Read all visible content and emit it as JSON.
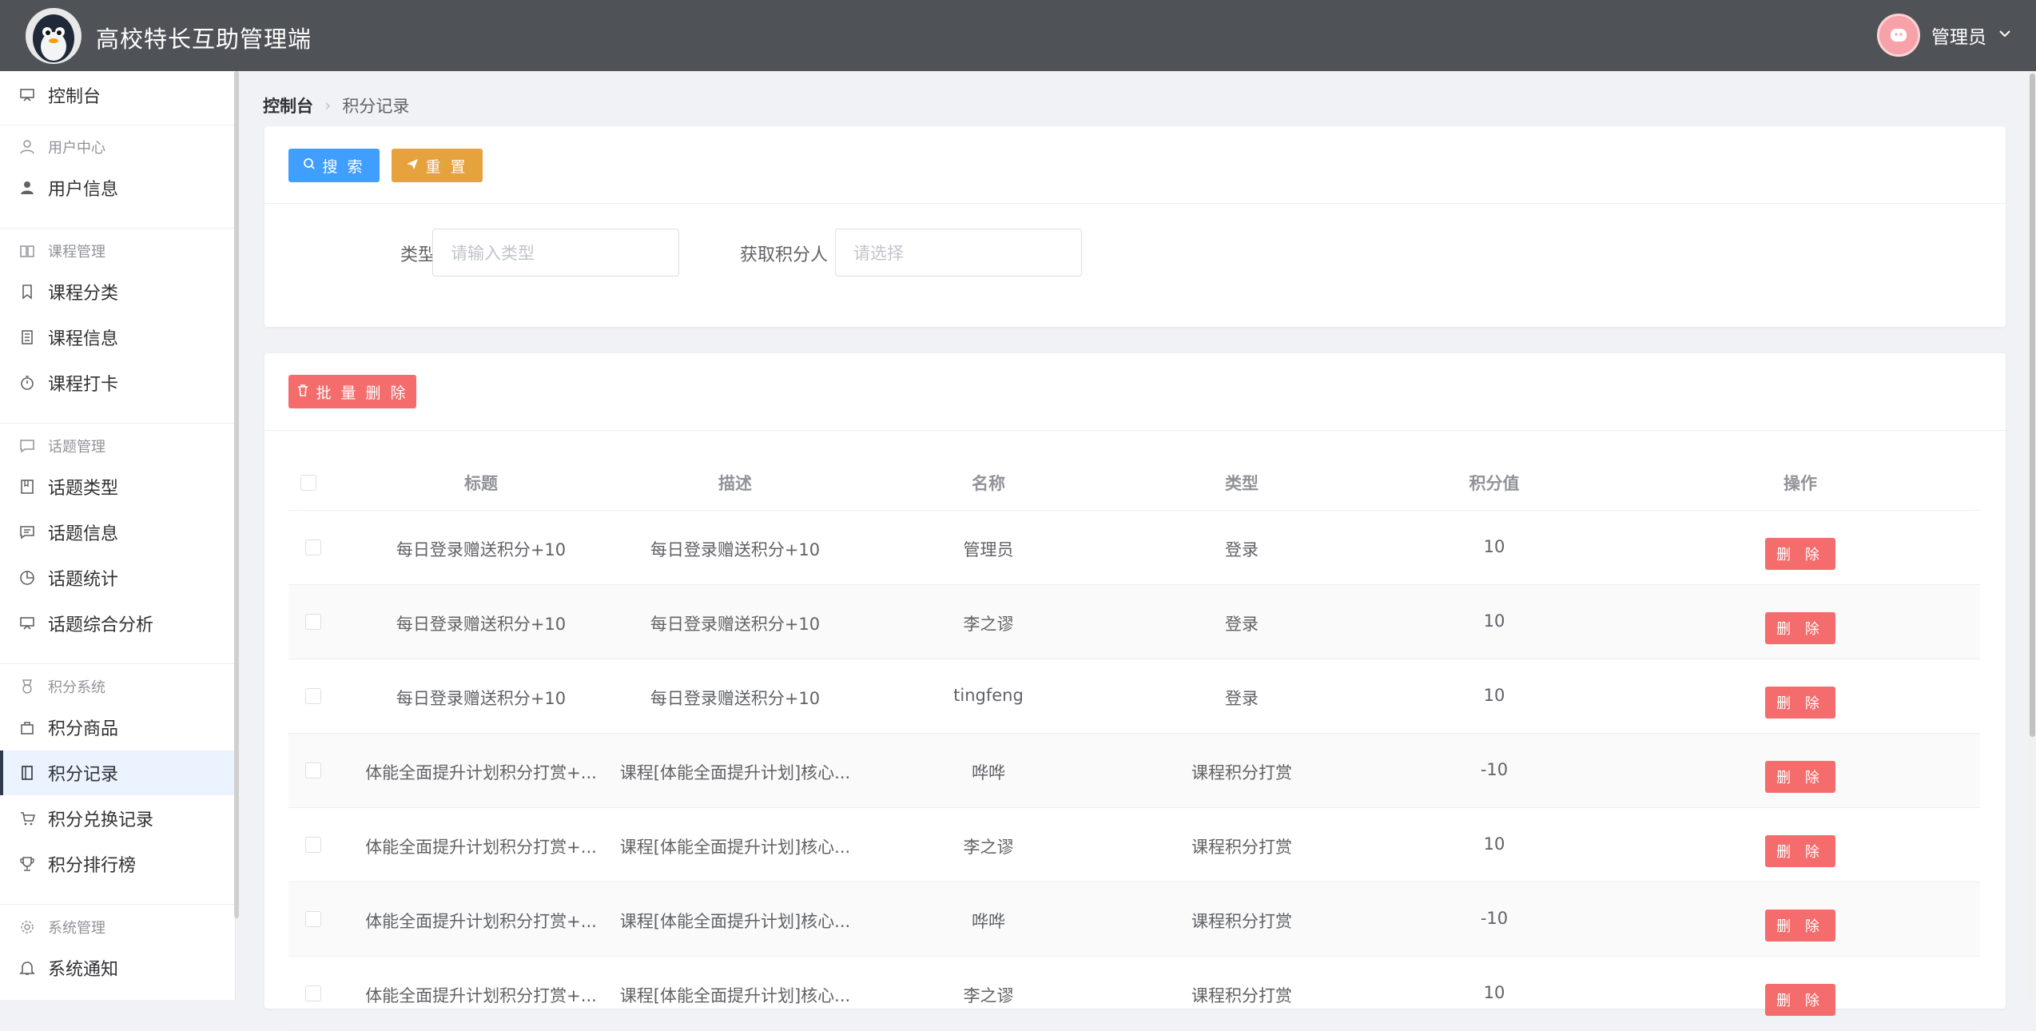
{
  "header": {
    "app_title": "高校特长互助管理端",
    "user_name": "管理员"
  },
  "sidebar": {
    "items": [
      {
        "label": "控制台",
        "icon": "dashboard-icon"
      },
      {
        "group": "用户中心",
        "icon": "user-outline-icon"
      },
      {
        "label": "用户信息",
        "icon": "user-icon"
      },
      {
        "group": "课程管理",
        "icon": "book-icon"
      },
      {
        "label": "课程分类",
        "icon": "bookmark-icon"
      },
      {
        "label": "课程信息",
        "icon": "document-icon"
      },
      {
        "label": "课程打卡",
        "icon": "timer-icon"
      },
      {
        "group": "话题管理",
        "icon": "chat-icon"
      },
      {
        "label": "话题类型",
        "icon": "notebook-icon"
      },
      {
        "label": "话题信息",
        "icon": "message-icon"
      },
      {
        "label": "话题统计",
        "icon": "pie-chart-icon"
      },
      {
        "label": "话题综合分析",
        "icon": "monitor-icon"
      },
      {
        "group": "积分系统",
        "icon": "medal-icon"
      },
      {
        "label": "积分商品",
        "icon": "bag-icon"
      },
      {
        "label": "积分记录",
        "icon": "notebook-icon",
        "active": true
      },
      {
        "label": "积分兑换记录",
        "icon": "cart-icon"
      },
      {
        "label": "积分排行榜",
        "icon": "trophy-icon"
      },
      {
        "group": "系统管理",
        "icon": "gear-icon"
      },
      {
        "label": "系统通知",
        "icon": "bell-icon"
      }
    ]
  },
  "breadcrumb": {
    "home": "控制台",
    "current": "积分记录"
  },
  "toolbar": {
    "search_label": "搜 索",
    "reset_label": "重 置",
    "batch_delete_label": "批 量 删 除"
  },
  "filters": {
    "type_label": "类型",
    "type_placeholder": "请输入类型",
    "user_label": "获取积分人",
    "user_placeholder": "请选择"
  },
  "table": {
    "columns": [
      "标题",
      "描述",
      "名称",
      "类型",
      "积分值",
      "操作"
    ],
    "delete_label": "删 除",
    "rows": [
      {
        "title": "每日登录赠送积分+10",
        "desc": "每日登录赠送积分+10",
        "name": "管理员",
        "type": "登录",
        "points": "10"
      },
      {
        "title": "每日登录赠送积分+10",
        "desc": "每日登录赠送积分+10",
        "name": "李之谬",
        "type": "登录",
        "points": "10"
      },
      {
        "title": "每日登录赠送积分+10",
        "desc": "每日登录赠送积分+10",
        "name": "tingfeng",
        "type": "登录",
        "points": "10"
      },
      {
        "title": "体能全面提升计划积分打赏+...",
        "desc": "课程[体能全面提升计划]核心...",
        "name": "哗哗",
        "type": "课程积分打赏",
        "points": "-10"
      },
      {
        "title": "体能全面提升计划积分打赏+...",
        "desc": "课程[体能全面提升计划]核心...",
        "name": "李之谬",
        "type": "课程积分打赏",
        "points": "10"
      },
      {
        "title": "体能全面提升计划积分打赏+...",
        "desc": "课程[体能全面提升计划]核心...",
        "name": "哗哗",
        "type": "课程积分打赏",
        "points": "-10"
      },
      {
        "title": "体能全面提升计划积分打赏+...",
        "desc": "课程[体能全面提升计划]核心...",
        "name": "李之谬",
        "type": "课程积分打赏",
        "points": "10"
      }
    ]
  }
}
